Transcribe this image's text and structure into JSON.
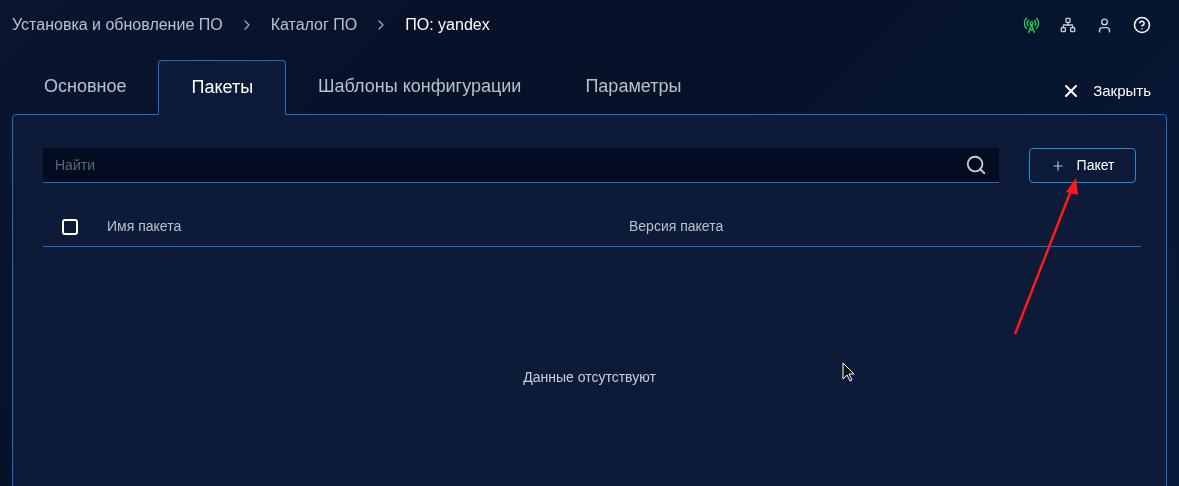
{
  "breadcrumbs": [
    {
      "label": "Установка и обновление ПО",
      "current": false
    },
    {
      "label": "Каталог ПО",
      "current": false
    },
    {
      "label": "ПО: yandex",
      "current": true
    }
  ],
  "tabs": [
    {
      "label": "Основное",
      "selected": false
    },
    {
      "label": "Пакеты",
      "selected": true
    },
    {
      "label": "Шаблоны конфигурации",
      "selected": false
    },
    {
      "label": "Параметры",
      "selected": false
    }
  ],
  "close": {
    "label": "Закрыть"
  },
  "search": {
    "placeholder": "Найти"
  },
  "add_button": {
    "label": "Пакет"
  },
  "table": {
    "select_all_checked": false,
    "columns": [
      "Имя пакета",
      "Версия пакета"
    ]
  },
  "empty_message": "Данные отсутствуют"
}
